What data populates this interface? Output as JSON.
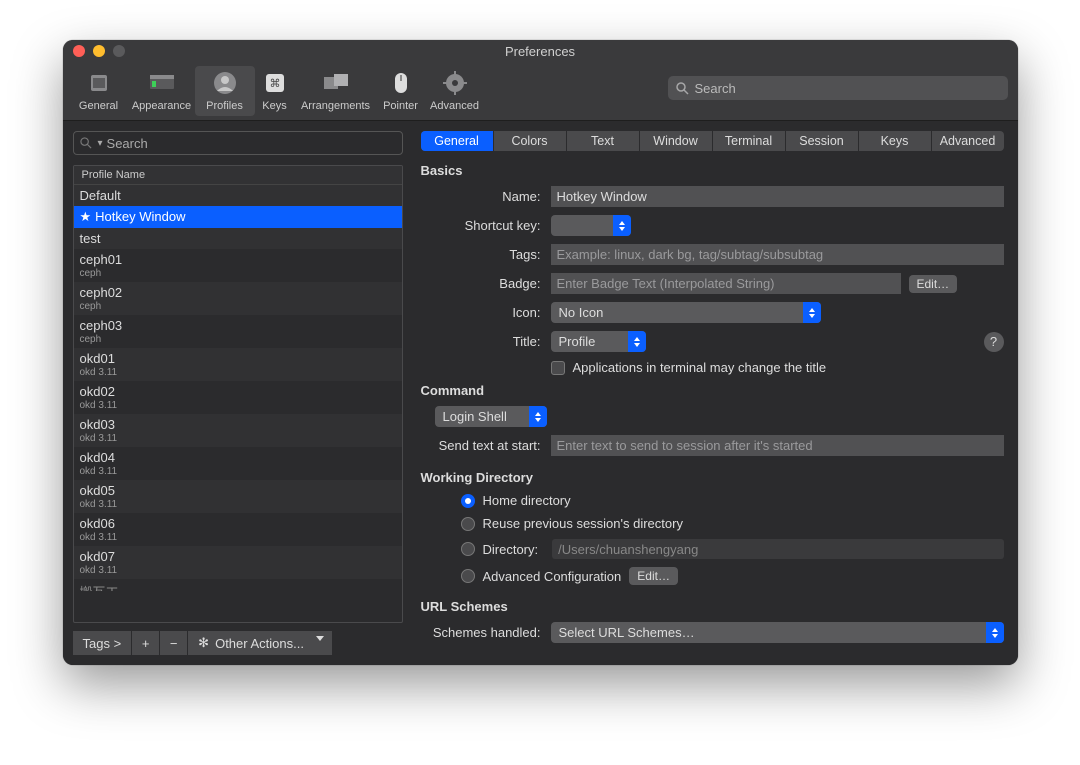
{
  "window": {
    "title": "Preferences"
  },
  "toolbar": {
    "items": [
      {
        "label": "General"
      },
      {
        "label": "Appearance"
      },
      {
        "label": "Profiles"
      },
      {
        "label": "Keys"
      },
      {
        "label": "Arrangements"
      },
      {
        "label": "Pointer"
      },
      {
        "label": "Advanced"
      }
    ],
    "search_placeholder": "Search"
  },
  "profiles": {
    "search_placeholder": "Search",
    "header": "Profile Name",
    "items": [
      {
        "name": "Default",
        "sub": ""
      },
      {
        "name": "Hotkey Window",
        "sub": "",
        "starred": true,
        "selected": true
      },
      {
        "name": "test",
        "sub": ""
      },
      {
        "name": "ceph01",
        "sub": "ceph"
      },
      {
        "name": "ceph02",
        "sub": "ceph"
      },
      {
        "name": "ceph03",
        "sub": "ceph"
      },
      {
        "name": "okd01",
        "sub": "okd 3.11"
      },
      {
        "name": "okd02",
        "sub": "okd 3.11"
      },
      {
        "name": "okd03",
        "sub": "okd 3.11"
      },
      {
        "name": "okd04",
        "sub": "okd 3.11"
      },
      {
        "name": "okd05",
        "sub": "okd 3.11"
      },
      {
        "name": "okd06",
        "sub": "okd 3.11"
      },
      {
        "name": "okd07",
        "sub": "okd 3.11"
      },
      {
        "name": "搬瓦工",
        "sub": ""
      }
    ],
    "bottom": {
      "tags": "Tags >",
      "plus": "+",
      "minus": "−",
      "other_actions": "Other Actions..."
    }
  },
  "tabs": [
    "General",
    "Colors",
    "Text",
    "Window",
    "Terminal",
    "Session",
    "Keys",
    "Advanced"
  ],
  "tabs_selected": 0,
  "basics": {
    "heading": "Basics",
    "name_label": "Name:",
    "name_value": "Hotkey Window",
    "shortcut_label": "Shortcut key:",
    "shortcut_value": "",
    "tags_label": "Tags:",
    "tags_placeholder": "Example: linux, dark bg, tag/subtag/subsubtag",
    "badge_label": "Badge:",
    "badge_placeholder": "Enter Badge Text (Interpolated String)",
    "badge_edit": "Edit…",
    "icon_label": "Icon:",
    "icon_value": "No Icon",
    "title_label": "Title:",
    "title_value": "Profile",
    "apps_change_title": "Applications in terminal may change the title"
  },
  "command": {
    "heading": "Command",
    "type": "Login Shell",
    "send_text_label": "Send text at start:",
    "send_text_placeholder": "Enter text to send to session after it's started"
  },
  "working_dir": {
    "heading": "Working Directory",
    "home": "Home directory",
    "reuse": "Reuse previous session's directory",
    "directory_label": "Directory:",
    "directory_value": "/Users/chuanshengyang",
    "advanced_label": "Advanced Configuration",
    "advanced_edit": "Edit…"
  },
  "url_schemes": {
    "heading": "URL Schemes",
    "label": "Schemes handled:",
    "value": "Select URL Schemes…"
  },
  "help": "?"
}
